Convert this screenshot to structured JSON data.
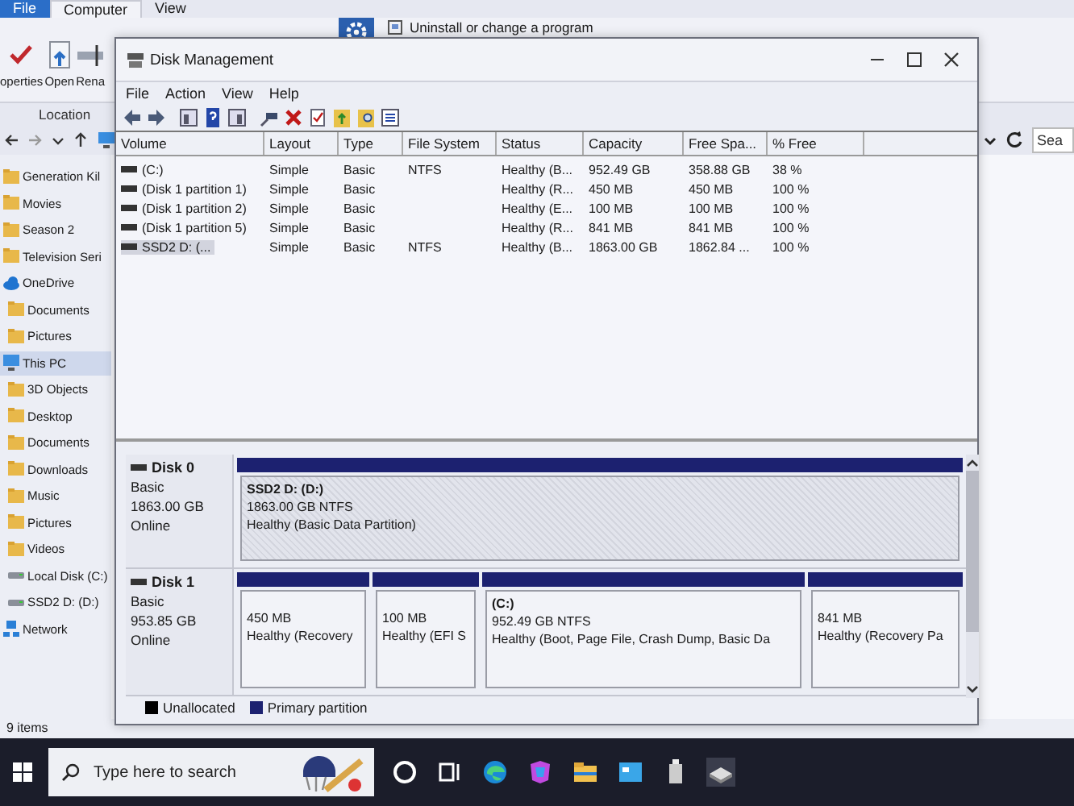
{
  "explorer": {
    "ribbon_tabs": [
      {
        "label": "File",
        "kind": "file",
        "selected": false
      },
      {
        "label": "Computer",
        "kind": "tab",
        "selected": true
      },
      {
        "label": "View",
        "kind": "tab",
        "selected": false
      }
    ],
    "ribbon_buttons": [
      {
        "label": "operties",
        "kind": "properties"
      },
      {
        "label": "Open",
        "kind": "open"
      },
      {
        "label": "Rena",
        "kind": "rename"
      }
    ],
    "ribbon_link": "Uninstall or change a program",
    "group_label": "Location",
    "search": {
      "placeholder": "Sea"
    },
    "sidebar": [
      {
        "label": "Generation Kil",
        "kind": "folder",
        "selected": false
      },
      {
        "label": "Movies",
        "kind": "folder",
        "selected": false
      },
      {
        "label": "Season 2",
        "kind": "folder",
        "selected": false
      },
      {
        "label": "Television Seri",
        "kind": "folder",
        "selected": false
      },
      {
        "label": "OneDrive",
        "kind": "cloud",
        "selected": false,
        "children": [
          {
            "label": "Documents",
            "kind": "folder",
            "selected": false
          },
          {
            "label": "Pictures",
            "kind": "folder",
            "selected": false
          }
        ]
      },
      {
        "label": "This PC",
        "kind": "pc",
        "selected": true,
        "children": [
          {
            "label": "3D Objects",
            "kind": "folder",
            "selected": false
          },
          {
            "label": "Desktop",
            "kind": "folder",
            "selected": false
          },
          {
            "label": "Documents",
            "kind": "folder",
            "selected": false
          },
          {
            "label": "Downloads",
            "kind": "folder",
            "selected": false
          },
          {
            "label": "Music",
            "kind": "folder",
            "selected": false
          },
          {
            "label": "Pictures",
            "kind": "folder",
            "selected": false
          },
          {
            "label": "Videos",
            "kind": "folder",
            "selected": false
          },
          {
            "label": "Local Disk (C:)",
            "kind": "drive",
            "selected": false
          },
          {
            "label": "SSD2 D: (D:)",
            "kind": "drive",
            "selected": false
          }
        ]
      },
      {
        "label": "Network",
        "kind": "network",
        "selected": false
      }
    ],
    "status_bar": "9 items"
  },
  "disk_management": {
    "title": "Disk Management",
    "menu": [
      "File",
      "Action",
      "View",
      "Help"
    ],
    "volumes": {
      "columns": [
        "Volume",
        "Layout",
        "Type",
        "File System",
        "Status",
        "Capacity",
        "Free Spa...",
        "% Free"
      ],
      "rows": [
        {
          "cells": [
            "(C:)",
            "Simple",
            "Basic",
            "NTFS",
            "Healthy (B...",
            "952.49 GB",
            "358.88 GB",
            "38 %"
          ],
          "selected": false
        },
        {
          "cells": [
            "(Disk 1 partition 1)",
            "Simple",
            "Basic",
            "",
            "Healthy (R...",
            "450 MB",
            "450 MB",
            "100 %"
          ],
          "selected": false
        },
        {
          "cells": [
            "(Disk 1 partition 2)",
            "Simple",
            "Basic",
            "",
            "Healthy (E...",
            "100 MB",
            "100 MB",
            "100 %"
          ],
          "selected": false
        },
        {
          "cells": [
            "(Disk 1 partition 5)",
            "Simple",
            "Basic",
            "",
            "Healthy (R...",
            "841 MB",
            "841 MB",
            "100 %"
          ],
          "selected": false
        },
        {
          "cells": [
            "SSD2 D: (...",
            "Simple",
            "Basic",
            "NTFS",
            "Healthy (B...",
            "1863.00 GB",
            "1862.84 ...",
            "100 %"
          ],
          "selected": true
        }
      ]
    },
    "disks": [
      {
        "name": "Disk 0",
        "type": "Basic",
        "size": "1863.00 GB",
        "state": "Online",
        "partitions": [
          {
            "name": "SSD2 D:  (D:)",
            "size": "1863.00 GB NTFS",
            "status": "Healthy (Basic Data Partition)",
            "selected": true
          }
        ]
      },
      {
        "name": "Disk 1",
        "type": "Basic",
        "size": "953.85 GB",
        "state": "Online",
        "partitions": [
          {
            "size": "450 MB",
            "status": "Healthy (Recovery",
            "selected": false
          },
          {
            "size": "100 MB",
            "status": "Healthy (EFI S",
            "selected": false
          },
          {
            "name": "(C:)",
            "size": "952.49 GB NTFS",
            "status": "Healthy (Boot, Page File, Crash Dump, Basic Da",
            "selected": false
          },
          {
            "size": "841 MB",
            "status": "Healthy (Recovery Pa",
            "selected": false
          }
        ]
      }
    ],
    "legend": [
      {
        "label": "Unallocated",
        "color": "#000000"
      },
      {
        "label": "Primary partition",
        "color": "#1c2170"
      }
    ]
  },
  "taskbar": {
    "search": {
      "placeholder": "Type here to search"
    }
  }
}
